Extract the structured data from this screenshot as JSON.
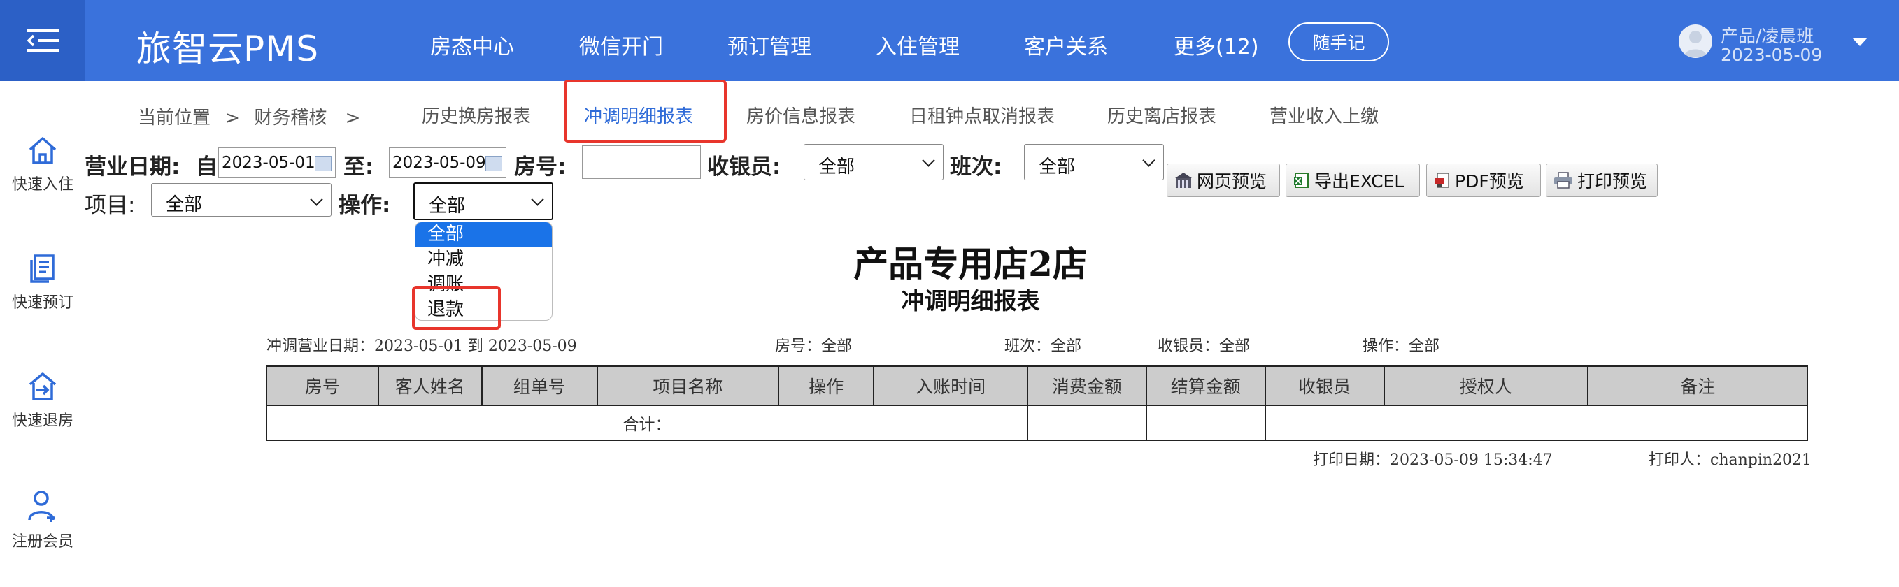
{
  "header": {
    "brand": "旅智云PMS",
    "nav": [
      "房态中心",
      "微信开门",
      "预订管理",
      "入住管理",
      "客户关系",
      "更多(12)"
    ],
    "memo_button": "随手记",
    "user_name": "产品/凌晨班",
    "user_date": "2023-05-09"
  },
  "sidebar": {
    "items": [
      {
        "label": "快速入住",
        "icon": "home-icon"
      },
      {
        "label": "快速预订",
        "icon": "document-icon"
      },
      {
        "label": "快速退房",
        "icon": "checkout-icon"
      },
      {
        "label": "注册会员",
        "icon": "add-user-icon"
      }
    ]
  },
  "breadcrumb": {
    "current": "当前位置",
    "separator": ">",
    "section": "财务稽核"
  },
  "tabs": [
    "历史换房报表",
    "冲调明细报表",
    "房价信息报表",
    "日租钟点取消报表",
    "历史离店报表",
    "营业收入上缴"
  ],
  "active_tab": "冲调明细报表",
  "filters": {
    "business_date_label": "营业日期:",
    "from_label": "自",
    "from_date": "2023-05-01",
    "to_label": "至:",
    "to_date": "2023-05-09",
    "room_label": "房号:",
    "room_value": "",
    "cashier_label": "收银员:",
    "cashier_value": "全部",
    "shift_label": "班次:",
    "shift_value": "全部",
    "item_label": "项目:",
    "item_value": "全部",
    "operation_label": "操作:",
    "operation_value": "全部"
  },
  "buttons": {
    "web_preview": "网页预览",
    "export_excel": "导出EXCEL",
    "pdf_preview": "PDF预览",
    "print_preview": "打印预览"
  },
  "operation_dropdown": {
    "options": [
      "全部",
      "冲减",
      "调账",
      "退款"
    ],
    "highlighted": "全部"
  },
  "report": {
    "hotel_name": "产品专用店2店",
    "title": "冲调明细报表",
    "meta": {
      "date_range": "冲调营业日期：2023-05-01 到 2023-05-09",
      "room": "房号：全部",
      "shift": "班次：全部",
      "cashier": "收银员：全部",
      "operation": "操作：全部"
    },
    "columns": [
      "房号",
      "客人姓名",
      "组单号",
      "项目名称",
      "操作",
      "入账时间",
      "消费金额",
      "结算金额",
      "收银员",
      "授权人",
      "备注"
    ],
    "total_label": "合计：",
    "print_date": "打印日期：2023-05-09 15:34:47",
    "printer": "打印人：chanpin2021"
  },
  "colors": {
    "header_bg": "#3a72dc",
    "menu_toggle_bg": "#2c60c6",
    "active_tab": "#2f6bd8",
    "highlight_box": "#e8352c",
    "dropdown_selected": "#1a73e8"
  }
}
